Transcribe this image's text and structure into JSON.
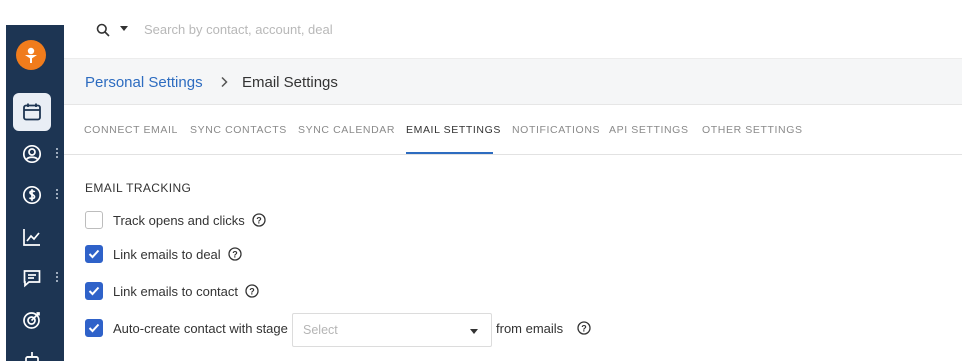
{
  "search": {
    "placeholder": "Search by contact, account, deal"
  },
  "breadcrumb": {
    "parent": "Personal Settings",
    "current": "Email Settings"
  },
  "tabs": [
    {
      "label": "CONNECT EMAIL"
    },
    {
      "label": "SYNC CONTACTS"
    },
    {
      "label": "SYNC CALENDAR"
    },
    {
      "label": "EMAIL SETTINGS"
    },
    {
      "label": "NOTIFICATIONS"
    },
    {
      "label": "API SETTINGS"
    },
    {
      "label": "OTHER SETTINGS"
    }
  ],
  "active_tab": "EMAIL SETTINGS",
  "section": {
    "title": "EMAIL TRACKING"
  },
  "options": [
    {
      "label": "Track opens and clicks",
      "checked": false
    },
    {
      "label": "Link emails to deal",
      "checked": true
    },
    {
      "label": "Link emails to contact",
      "checked": true
    },
    {
      "label": "Auto-create contact with stage",
      "checked": true
    }
  ],
  "stage_select": {
    "placeholder": "Select",
    "after_text": "from emails"
  },
  "sidebar": {
    "items": [
      {
        "icon": "calendar-icon"
      },
      {
        "icon": "contacts-icon"
      },
      {
        "icon": "deals-icon"
      },
      {
        "icon": "reports-icon"
      },
      {
        "icon": "messages-icon"
      },
      {
        "icon": "goals-icon"
      },
      {
        "icon": "integrations-icon"
      }
    ]
  },
  "colors": {
    "sidebar": "#1d3553",
    "accent": "#2d6cc0",
    "checkbox": "#2f62c9",
    "logo": "#f07c1c"
  }
}
